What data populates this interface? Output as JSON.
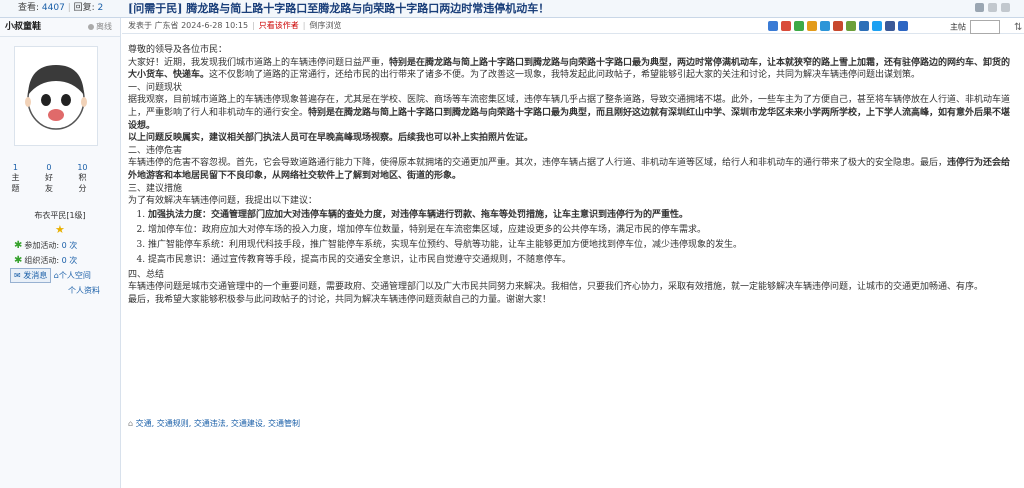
{
  "stats": {
    "views_label": "查看:",
    "views": "4407",
    "replies_label": "回复:",
    "replies": "2"
  },
  "title": {
    "tag": "[问需于民]",
    "text": "腾龙路与简上路十字路口至腾龙路与向荣路十字路口两边时常违停机动车！"
  },
  "user": {
    "name": "小叔童鞋",
    "status": "离线",
    "topics": "1",
    "topics_label": "主题",
    "friends": "0",
    "friends_label": "好友",
    "points": "10",
    "points_label": "积分",
    "rank": "布衣平民[1级]",
    "activity1_label": "参加活动:",
    "activity1_value": "0 次",
    "activity2_label": "组织活动:",
    "activity2_value": "0 次",
    "msg_label": "发消息",
    "space_label": "个人空间",
    "profile_label": "个人资料"
  },
  "meta": {
    "posted": "发表于 广东省 2024-6-28 10:15",
    "author_only": "只看该作者",
    "reverse": "倒序浏览",
    "jump_label": "主帖"
  },
  "content": {
    "greet": "尊敬的领导及各位市民：",
    "p1a": "大家好！近期，我发现我们城市道路上的车辆违停问题日益严重，",
    "p1b": "特别是在腾龙路与简上路十字路口到腾龙路与向荣路十字路口最为典型，两边时常停满机动车，让本就狭窄的路上雪上加霜，还有驻停路边的网约车、卸货的大小货车、快递车。",
    "p1c": "这不仅影响了道路的正常通行，还给市民的出行带来了诸多不便。为了改善这一现象，我特发起此问政帖子，希望能够引起大家的关注和讨论，共同为解决车辆违停问题出谋划策。",
    "h1": "一、问题现状",
    "p2a": "据我观察，目前城市道路上的车辆违停现象普遍存在，尤其是在学校、医院、商场等车流密集区域，违停车辆几乎占据了整条道路，导致交通拥堵不堪。此外，一些车主为了方便自己，甚至将车辆停放在人行道、非机动车道上，严重影响了行人和非机动车的通行安全。",
    "p2b": "特别是在腾龙路与简上路十字路口到腾龙路与向荣路十字路口最为典型，而且刚好这边就有深圳红山中学、深圳市龙华区未来小学两所学校，上下学人流高峰，如有意外后果不堪设想。",
    "p3": "以上问题反映属实，建议相关部门执法人员可在早晚高峰现场视察。后续我也可以补上实拍照片佐证。",
    "h2": "二、违停危害",
    "p4a": "车辆违停的危害不容忽视。首先，它会导致道路通行能力下降，使得原本就拥堵的交通更加严重。其次，违停车辆占据了人行道、非机动车道等区域，给行人和非机动车的通行带来了极大的安全隐患。最后，",
    "p4b": "违停行为还会给外地游客和本地居民留下不良印象，从网络社交软件上了解到对地区、街道的形象。",
    "h3": "三、建议措施",
    "p5": "为了有效解决车辆违停问题，我提出以下建议：",
    "li1": "加强执法力度：交通管理部门应加大对违停车辆的查处力度，对违停车辆进行罚款、拖车等处罚措施，让车主意识到违停行为的严重性。",
    "li2": "增加停车位：政府应加大对停车场的投入力度，增加停车位数量，特别是在车流密集区域，应建设更多的公共停车场，满足市民的停车需求。",
    "li3": "推广智能停车系统：利用现代科技手段，推广智能停车系统，实现车位预约、导航等功能，让车主能够更加方便地找到停车位，减少违停现象的发生。",
    "li4": "提高市民意识：通过宣传教育等手段，提高市民的交通安全意识，让市民自觉遵守交通规则，不随意停车。",
    "h4": "四、总结",
    "p6": "车辆违停问题是城市交通管理中的一个重要问题，需要政府、交通管理部门以及广大市民共同努力来解决。我相信，只要我们齐心协力，采取有效措施，就一定能够解决车辆违停问题，让城市的交通更加畅通、有序。",
    "p7": "最后，我希望大家能够积极参与此问政帖子的讨论，共同为解决车辆违停问题贡献自己的力量。谢谢大家！"
  },
  "tags": [
    "交通",
    "交通规则",
    "交通违法",
    "交通建设",
    "交通管制"
  ],
  "colors": {
    "accent": "#1a5fa8",
    "red": "#cc0000",
    "title": "#1a3f7a"
  }
}
